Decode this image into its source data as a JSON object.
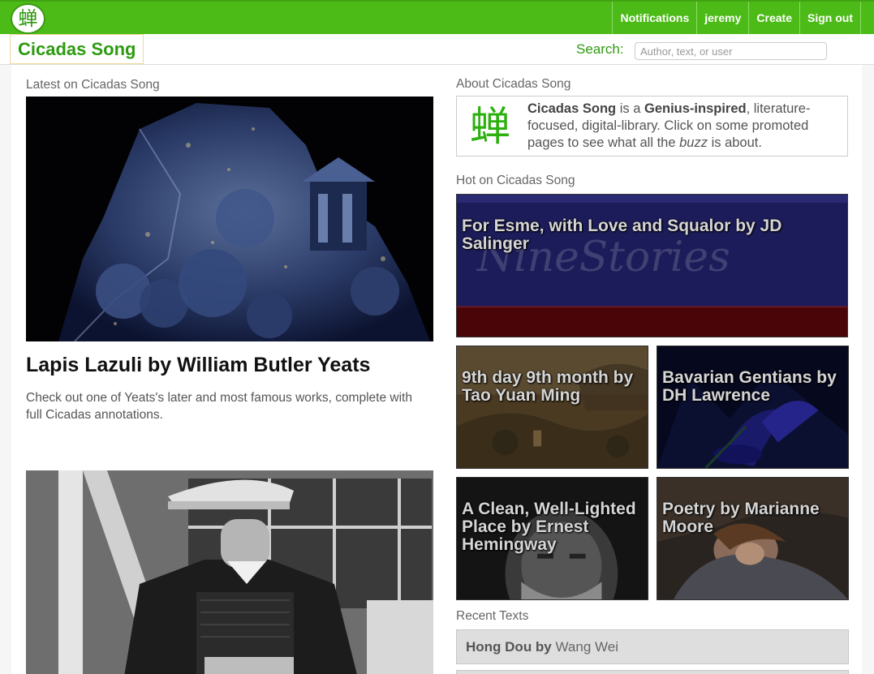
{
  "topbar": {
    "logo_glyph": "蝉",
    "nav": [
      "Notifications",
      "jeremy",
      "Create",
      "Sign out"
    ]
  },
  "header": {
    "brand": "Cicadas Song",
    "search_label": "Search:",
    "search_placeholder": "Author, text, or user"
  },
  "latest": {
    "label": "Latest on Cicadas Song",
    "title": "Lapis Lazuli by William Butler Yeats",
    "description": "Check out one of Yeats's later and most famous works, complete with full Cicadas annotations."
  },
  "about": {
    "label": "About Cicadas Song",
    "glyph": "蝉",
    "brand_bold": "Cicadas Song",
    "text_1": " is a ",
    "genius_bold": "Genius-inspired",
    "text_2": ", literature-focused, digital-library. Click on some promoted pages to see what all the ",
    "buzz_italic": "buzz",
    "text_3": " is about."
  },
  "hot": {
    "label": "Hot on Cicadas Song",
    "tiles": [
      {
        "title": "For Esme, with Love and Squalor by JD Salinger"
      },
      {
        "title": "9th day 9th month by Tao Yuan Ming"
      },
      {
        "title": "Bavarian Gentians by DH Lawrence"
      },
      {
        "title": "A Clean, Well-Lighted Place by Ernest Hemingway"
      },
      {
        "title": "Poetry by Marianne Moore"
      }
    ]
  },
  "recent": {
    "label": "Recent Texts",
    "items": [
      {
        "title": "Hong Dou",
        "by": " by ",
        "author": "Wang Wei"
      }
    ]
  },
  "colors": {
    "brand_green": "#4cbb17",
    "text_green": "#2e9a10"
  }
}
